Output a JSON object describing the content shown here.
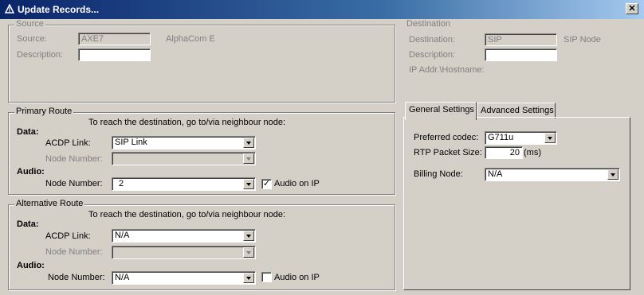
{
  "window": {
    "title": "Update Records...",
    "close_label": "✕"
  },
  "source": {
    "legend": "Source",
    "source_label": "Source:",
    "source_value": "AXE7",
    "source_type": "AlphaCom E",
    "description_label": "Description:",
    "description_value": ""
  },
  "destination": {
    "legend": "Destination",
    "destination_label": "Destination:",
    "destination_value": "SIP",
    "destination_type": "SIP Node",
    "description_label": "Description:",
    "description_value": "",
    "ip_label": "IP Addr.\\Hostname:"
  },
  "primary_route": {
    "legend": "Primary Route",
    "instruction": "To reach the destination, go to/via neighbour node:",
    "data_label": "Data:",
    "acdp_label": "ACDP Link:",
    "acdp_value": "SIP Link",
    "node_number_label": "Node Number:",
    "node_number_value": "",
    "audio_label": "Audio:",
    "audio_node_label": "Node Number:",
    "audio_node_value": "2",
    "audio_on_ip_label": "Audio on IP",
    "audio_on_ip_checked": true
  },
  "alternative_route": {
    "legend": "Alternative Route",
    "instruction": "To reach the destination, go to/via neighbour node:",
    "data_label": "Data:",
    "acdp_label": "ACDP Link:",
    "acdp_value": "N/A",
    "node_number_label": "Node Number:",
    "node_number_value": "",
    "audio_label": "Audio:",
    "audio_node_label": "Node Number:",
    "audio_node_value": "N/A",
    "audio_on_ip_label": "Audio on IP",
    "audio_on_ip_checked": false
  },
  "tabs": [
    {
      "label": "General Settings",
      "active": true
    },
    {
      "label": "Advanced Settings",
      "active": false
    }
  ],
  "general_settings": {
    "codec_label": "Preferred codec:",
    "codec_value": "G711u",
    "rtp_label": "RTP Packet Size:",
    "rtp_value": "20",
    "rtp_unit": "(ms)",
    "billing_label": "Billing Node:",
    "billing_value": "N/A"
  }
}
